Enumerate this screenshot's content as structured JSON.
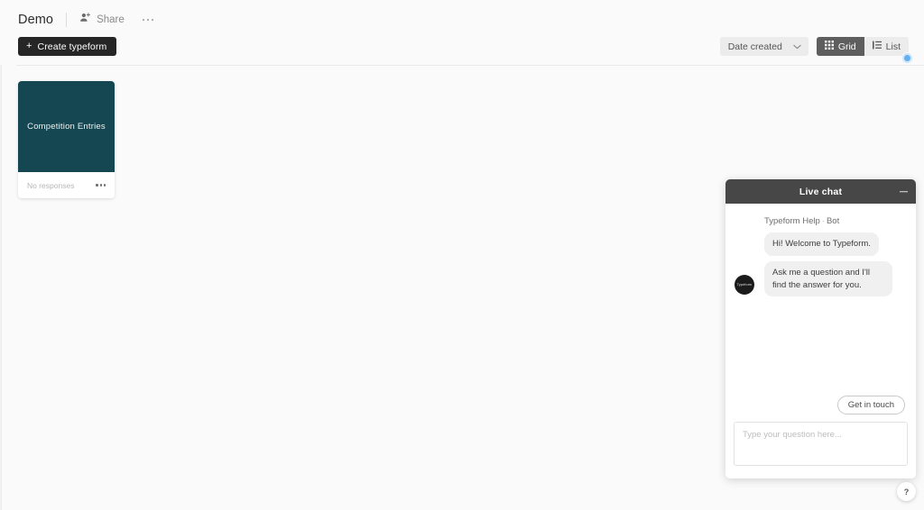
{
  "header": {
    "workspace_title": "Demo",
    "share_label": "Share",
    "share_icon": "person-plus-icon",
    "more_icon": "more-horizontal-icon",
    "create_button_label": "Create typeform",
    "create_button_icon": "plus-icon"
  },
  "toolbar": {
    "sort_value": "Date created",
    "sort_chevron_icon": "chevron-down-icon",
    "grid_label": "Grid",
    "grid_icon": "grid-icon",
    "list_label": "List",
    "list_icon": "list-icon",
    "notification_badge": ""
  },
  "forms": [
    {
      "title": "Competition Entries",
      "status": "No responses",
      "menu_icon": "more-horizontal-icon",
      "thumb_color": "#144751"
    }
  ],
  "chat": {
    "title": "Live chat",
    "minimize_icon": "minimize-icon",
    "bot_name": "Typeform Help",
    "bot_separator": "·",
    "bot_role": "Bot",
    "messages": [
      {
        "text": "Hi! Welcome to Typeform."
      },
      {
        "text": "Ask me a question and I'll find the answer for you."
      }
    ],
    "avatar_label": "Typeform",
    "cta_label": "Get in touch",
    "input_value": "",
    "input_placeholder": "Type your question here..."
  },
  "help": {
    "label": "?",
    "icon": "question-mark-icon"
  },
  "colors": {
    "background": "#fafafa",
    "card_thumb": "#144751",
    "chat_header": "#474747",
    "create_button": "#262626",
    "badge_blue": "#64b0ee"
  }
}
